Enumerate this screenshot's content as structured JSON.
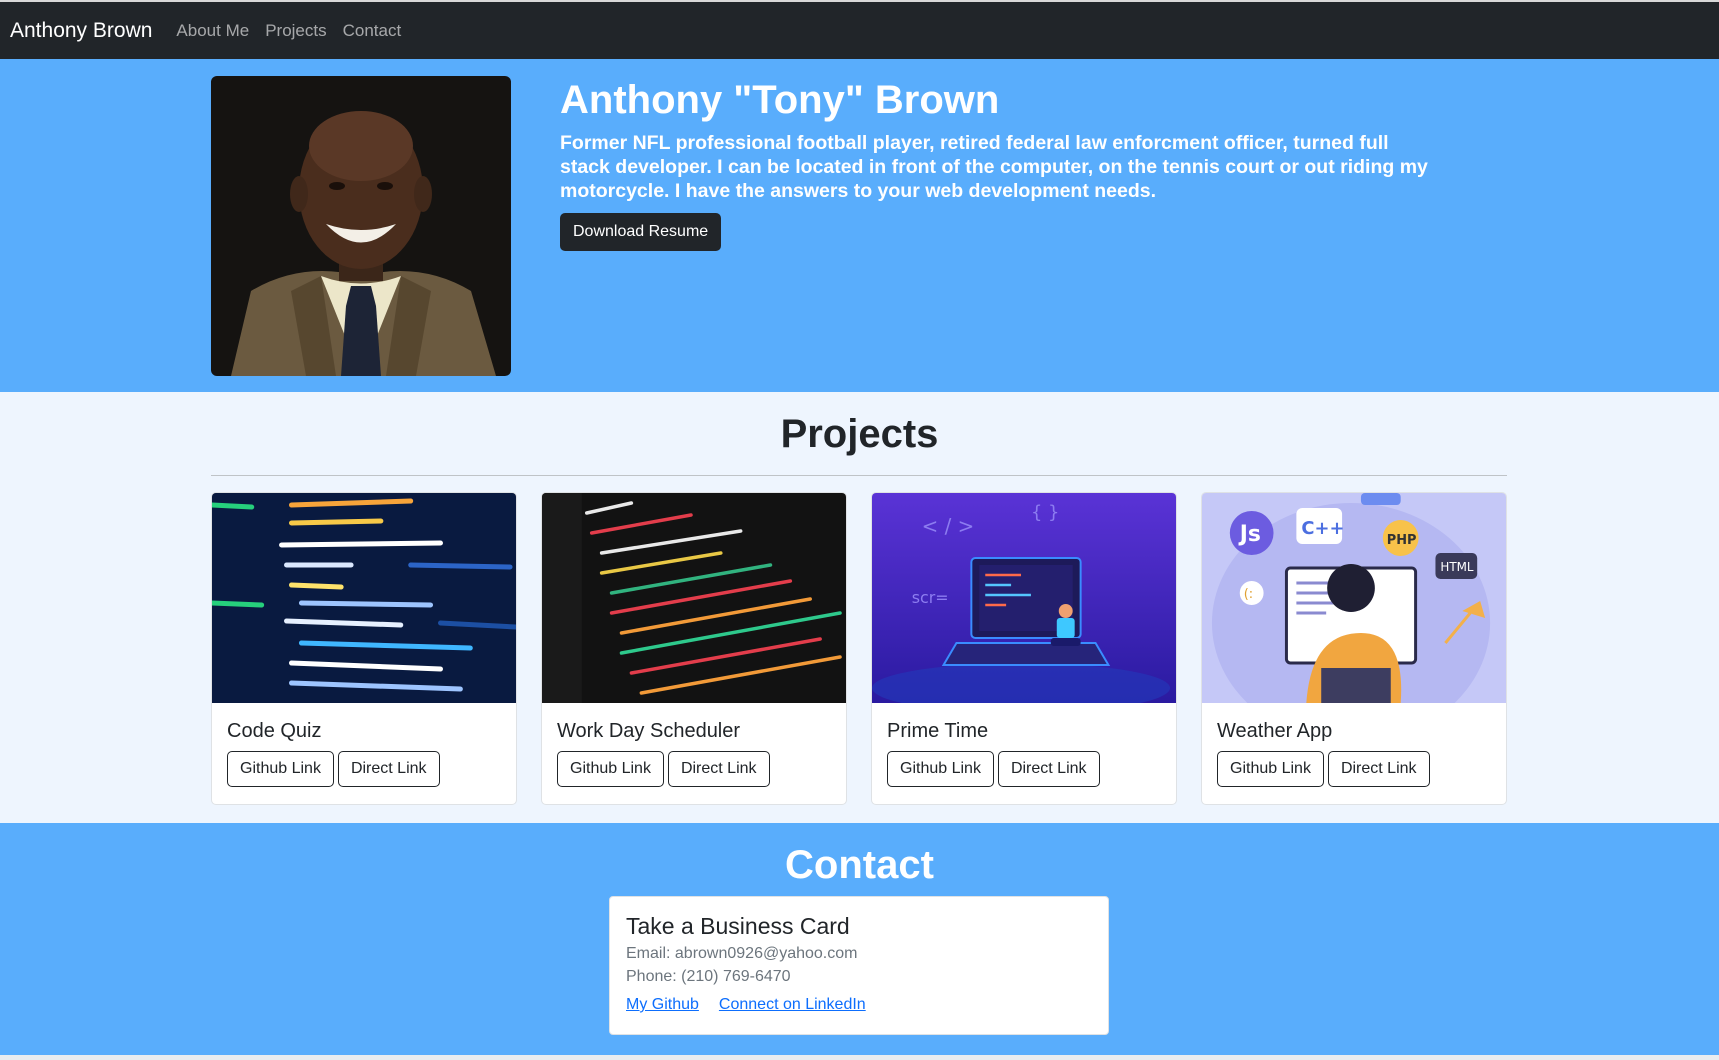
{
  "nav": {
    "brand": "Anthony Brown",
    "links": [
      "About Me",
      "Projects",
      "Contact"
    ]
  },
  "hero": {
    "title": "Anthony \"Tony\" Brown",
    "bio": "Former NFL professional football player, retired federal law enforcment officer, turned full stack developer. I can be located in front of the computer, on the tennis court or out riding my motorcycle. I have the answers to your web development needs.",
    "button": "Download Resume"
  },
  "projects": {
    "title": "Projects",
    "cards": [
      {
        "title": "Code Quiz",
        "github": "Github Link",
        "direct": "Direct Link"
      },
      {
        "title": "Work Day Scheduler",
        "github": "Github Link",
        "direct": "Direct Link"
      },
      {
        "title": "Prime Time",
        "github": "Github Link",
        "direct": "Direct Link"
      },
      {
        "title": "Weather App",
        "github": "Github Link",
        "direct": "Direct Link"
      }
    ]
  },
  "contact": {
    "title": "Contact",
    "card_title": "Take a Business Card",
    "email": "Email: abrown0926@yahoo.com",
    "phone": "Phone: (210) 769-6470",
    "github_link": "My Github",
    "linkedin_link": "Connect on LinkedIn"
  },
  "colors": {
    "navbar": "#212529",
    "hero_bg": "#59adfc",
    "projects_bg": "#eef5fe",
    "link": "#0d6efd"
  }
}
